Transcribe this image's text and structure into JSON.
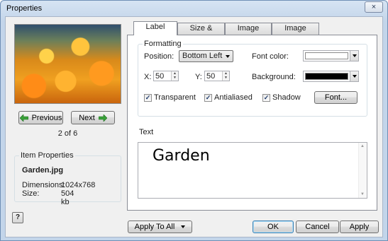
{
  "window": {
    "title": "Properties",
    "close_glyph": "×"
  },
  "preview": {
    "image_alt": "orange flowers"
  },
  "nav": {
    "previous_label": "Previous",
    "next_label": "Next",
    "counter": "2 of 6"
  },
  "item_properties": {
    "title": "Item Properties",
    "filename": "Garden.jpg",
    "dimensions_label": "Dimensions:",
    "dimensions_value": "1024x768",
    "size_label": "Size:",
    "size_value": "504 kb"
  },
  "tabs": [
    {
      "label": "Label",
      "active": true
    },
    {
      "label": "Size & Position",
      "active": false
    },
    {
      "label": "Image",
      "active": false
    },
    {
      "label": "Image Effects",
      "active": false
    }
  ],
  "formatting": {
    "title": "Formatting",
    "position_label": "Position:",
    "position_value": "Bottom Left",
    "x_label": "X:",
    "x_value": "50",
    "y_label": "Y:",
    "y_value": "50",
    "font_color_label": "Font color:",
    "font_color_value": "#ffffff",
    "background_label": "Background:",
    "background_value": "#000000",
    "transparent_label": "Transparent",
    "transparent_checked": true,
    "antialiased_label": "Antialiased",
    "antialiased_checked": true,
    "shadow_label": "Shadow",
    "shadow_checked": true,
    "font_button_label": "Font..."
  },
  "text_group": {
    "title": "Text",
    "value": "Garden"
  },
  "footer": {
    "apply_to_all_label": "Apply To All",
    "ok_label": "OK",
    "cancel_label": "Cancel",
    "apply_label": "Apply",
    "help_glyph": "?"
  },
  "colors": {
    "accent": "#3c7fb1",
    "arrow_green": "#3aa13a"
  }
}
